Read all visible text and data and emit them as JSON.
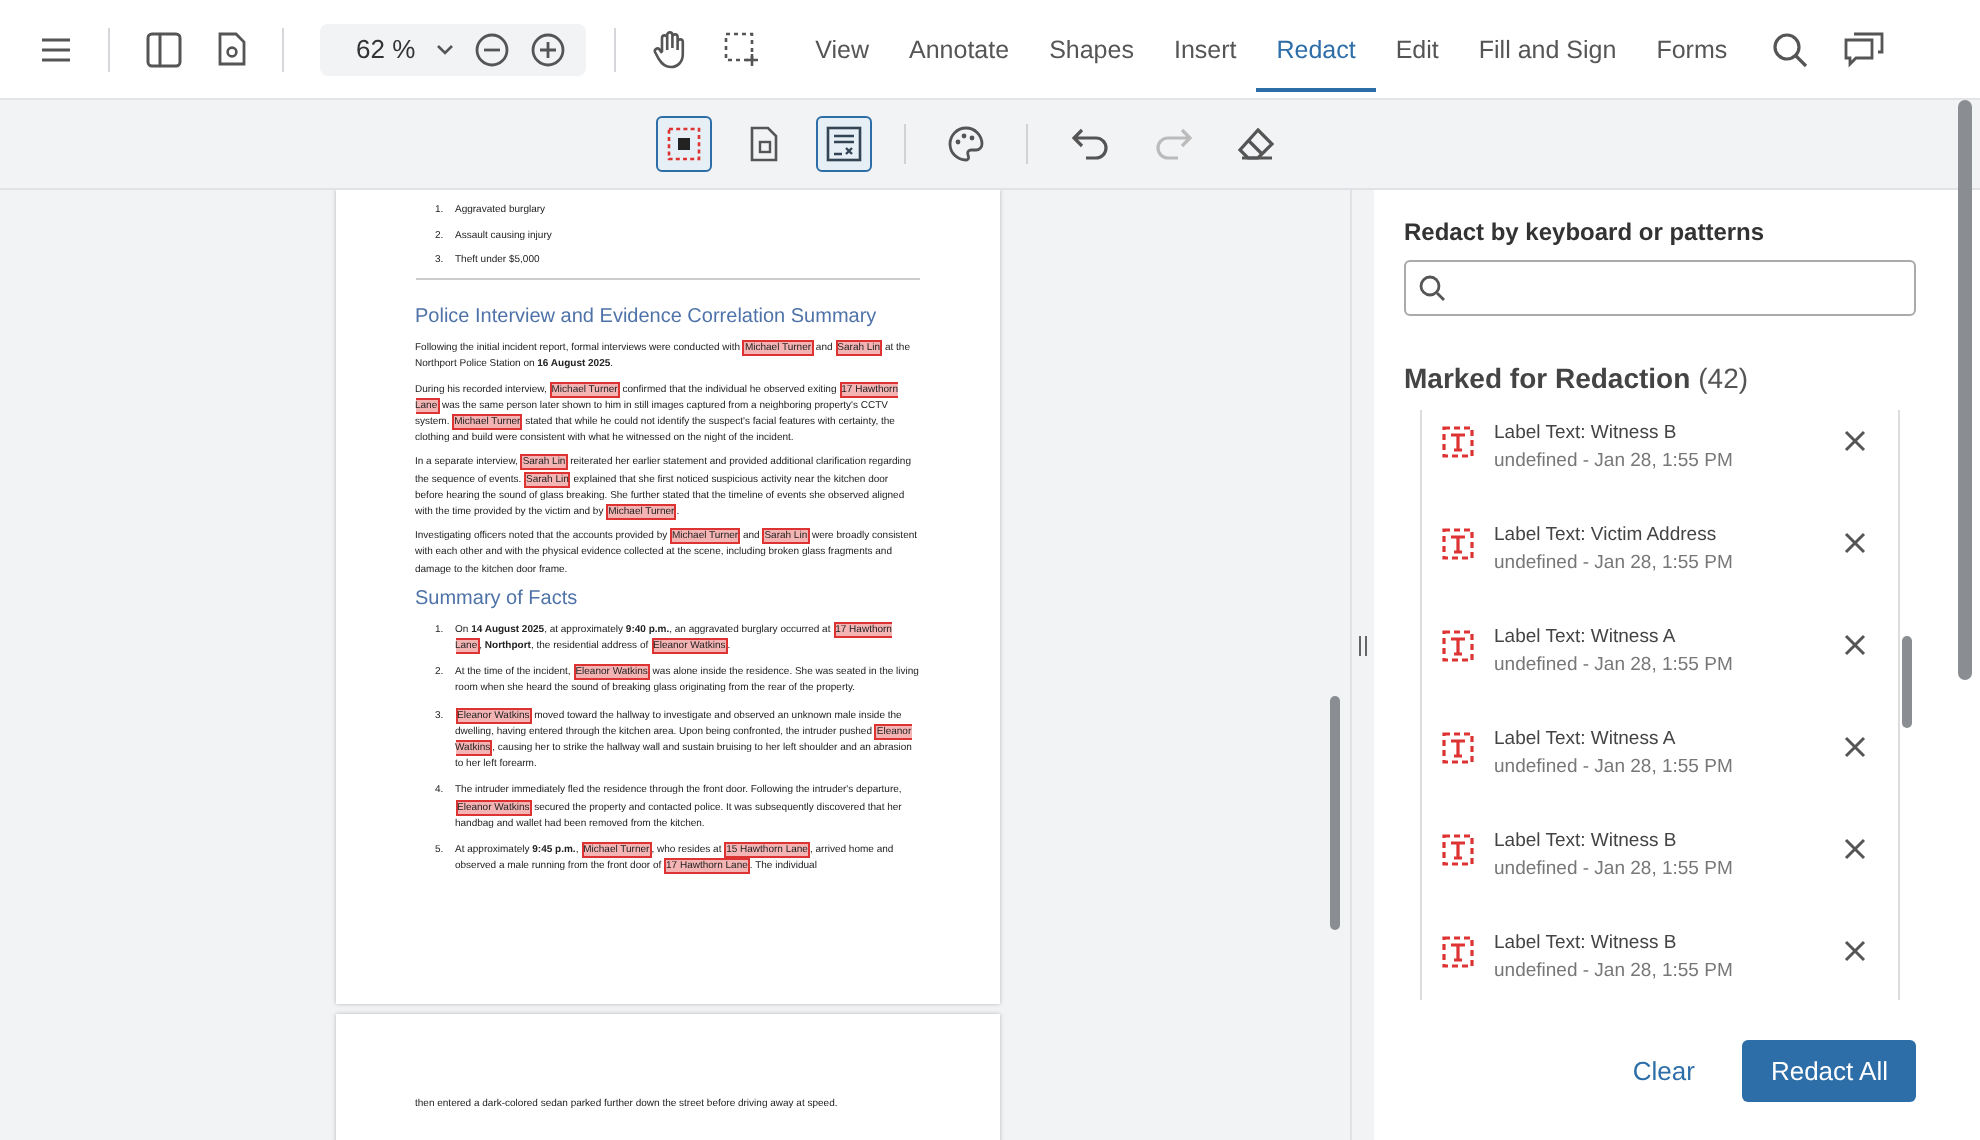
{
  "toolbar": {
    "zoom": "62 %",
    "tabs": [
      {
        "label": "View",
        "selected": false
      },
      {
        "label": "Annotate",
        "selected": false
      },
      {
        "label": "Shapes",
        "selected": false
      },
      {
        "label": "Insert",
        "selected": false
      },
      {
        "label": "Redact",
        "selected": true
      },
      {
        "label": "Edit",
        "selected": false
      },
      {
        "label": "Fill and Sign",
        "selected": false
      },
      {
        "label": "Forms",
        "selected": false
      }
    ]
  },
  "redact_tools": [
    {
      "kind": "area",
      "selected": true
    },
    {
      "kind": "page",
      "selected": false
    },
    {
      "kind": "panel",
      "selected": true
    }
  ],
  "edit_tools": [
    {
      "kind": "palette",
      "disabled": false
    },
    {
      "kind": "undo",
      "disabled": false
    },
    {
      "kind": "redo",
      "disabled": true
    },
    {
      "kind": "eraser",
      "disabled": false
    }
  ],
  "document": {
    "pages": [
      {
        "blocks": [
          {
            "kind": "item",
            "number": "1.",
            "segments": [
              {
                "kind": "text",
                "text": "Aggravated burglary"
              }
            ]
          },
          {
            "kind": "item",
            "number": "2.",
            "segments": [
              {
                "kind": "text",
                "text": "Assault causing injury"
              }
            ]
          },
          {
            "kind": "item",
            "number": "3.",
            "segments": [
              {
                "kind": "text",
                "text": "Theft under $5,000"
              }
            ]
          },
          {
            "kind": "rule"
          },
          {
            "kind": "heading",
            "text": "Police Interview and Evidence Correlation Summary"
          },
          {
            "kind": "para",
            "segments": [
              {
                "kind": "text",
                "text": "Following the initial incident report, formal interviews were conducted with "
              },
              {
                "kind": "redacted",
                "text": "Michael Turner"
              },
              {
                "kind": "text",
                "text": " and "
              },
              {
                "kind": "redacted",
                "text": "Sarah Lin"
              },
              {
                "kind": "text",
                "text": " at the Northport Police Station on **16 August 2025**."
              }
            ]
          },
          {
            "kind": "para",
            "segments": [
              {
                "kind": "text",
                "text": "During his recorded interview, "
              },
              {
                "kind": "redacted",
                "text": "Michael Turner"
              },
              {
                "kind": "text",
                "text": " confirmed that the individual he observed exiting "
              },
              {
                "kind": "redacted",
                "text": "17 Hawthorn Lane"
              },
              {
                "kind": "text",
                "text": " was the same person later shown to him in still images captured from a neighboring property's CCTV system. "
              },
              {
                "kind": "redacted",
                "text": "Michael Turner"
              },
              {
                "kind": "text",
                "text": " stated that while he could not identify the suspect's facial features with certainty, the clothing and build were consistent with what he witnessed on the night of the incident."
              }
            ]
          },
          {
            "kind": "para",
            "segments": [
              {
                "kind": "text",
                "text": "In a separate interview, "
              },
              {
                "kind": "redacted",
                "text": "Sarah Lin"
              },
              {
                "kind": "text",
                "text": " reiterated her earlier statement and provided additional clarification regarding the sequence of events. "
              },
              {
                "kind": "redacted",
                "text": "Sarah Lin"
              },
              {
                "kind": "text",
                "text": " explained that she first noticed suspicious activity near the kitchen door before hearing the sound of glass breaking. She further stated that the timeline of events she observed aligned with the time provided by the victim and by "
              },
              {
                "kind": "redacted",
                "text": "Michael Turner"
              },
              {
                "kind": "text",
                "text": "."
              }
            ]
          },
          {
            "kind": "para",
            "segments": [
              {
                "kind": "text",
                "text": "Investigating officers noted that the accounts provided by "
              },
              {
                "kind": "redacted",
                "text": "Michael Turner"
              },
              {
                "kind": "text",
                "text": " and "
              },
              {
                "kind": "redacted",
                "text": "Sarah Lin"
              },
              {
                "kind": "text",
                "text": " were broadly consistent with each other and with the physical evidence collected at the scene, including broken glass fragments and damage to the kitchen door frame."
              }
            ]
          },
          {
            "kind": "heading",
            "text": "Summary of Facts"
          },
          {
            "kind": "fact",
            "number": "1.",
            "segments": [
              {
                "kind": "text",
                "text": "On **14 August 2025**, at approximately **9:40 p.m.**, an aggravated burglary occurred at "
              },
              {
                "kind": "redacted",
                "text": "17 Hawthorn Lane"
              },
              {
                "kind": "text",
                "text": ", **Northport**, the residential address of "
              },
              {
                "kind": "redacted",
                "text": "Eleanor Watkins"
              },
              {
                "kind": "text",
                "text": "."
              }
            ]
          },
          {
            "kind": "fact",
            "number": "2.",
            "segments": [
              {
                "kind": "text",
                "text": "At the time of the incident, "
              },
              {
                "kind": "redacted",
                "text": "Eleanor Watkins"
              },
              {
                "kind": "text",
                "text": " was alone inside the residence. She was seated in the living room when she heard the sound of breaking glass originating from the rear of the property."
              }
            ]
          },
          {
            "kind": "fact",
            "number": "3.",
            "segments": [
              {
                "kind": "redacted",
                "text": "Eleanor Watkins"
              },
              {
                "kind": "text",
                "text": " moved toward the hallway to investigate and observed an unknown male inside the dwelling, having entered through the kitchen area. Upon being confronted, the intruder pushed "
              },
              {
                "kind": "redacted",
                "text": "Eleanor Watkins"
              },
              {
                "kind": "text",
                "text": ", causing her to strike the hallway wall and sustain bruising to her left shoulder and an abrasion to her left forearm."
              }
            ]
          },
          {
            "kind": "fact",
            "number": "4.",
            "segments": [
              {
                "kind": "text",
                "text": "The intruder immediately fled the residence through the front door. Following the intruder's departure, "
              },
              {
                "kind": "redacted",
                "text": "Eleanor Watkins"
              },
              {
                "kind": "text",
                "text": " secured the property and contacted police. It was subsequently discovered that her handbag and wallet had been removed from the kitchen."
              }
            ]
          },
          {
            "kind": "fact",
            "number": "5.",
            "segments": [
              {
                "kind": "text",
                "text": "At approximately **9:45 p.m.**, "
              },
              {
                "kind": "redacted",
                "text": "Michael Turner"
              },
              {
                "kind": "text",
                "text": ", who resides at "
              },
              {
                "kind": "redacted",
                "text": "15 Hawthorn Lane"
              },
              {
                "kind": "text",
                "text": ", arrived home and observed a male running from the front door of "
              },
              {
                "kind": "redacted",
                "text": "17 Hawthorn Lane"
              },
              {
                "kind": "text",
                "text": ". The individual"
              }
            ]
          }
        ]
      },
      {
        "blocks": [
          {
            "kind": "continuation",
            "segments": [
              {
                "kind": "text",
                "text": "then entered a dark-colored sedan parked further down the street before driving away at speed."
              }
            ]
          }
        ]
      }
    ]
  },
  "panel": {
    "title": "Redact by keyboard or patterns",
    "marked_title": "Marked for Redaction",
    "count": "(42)",
    "items": [
      {
        "title": "Label Text: Witness B",
        "subtitle": "undefined - Jan 28, 1:55 PM"
      },
      {
        "title": "Label Text: Victim Address",
        "subtitle": "undefined - Jan 28, 1:55 PM"
      },
      {
        "title": "Label Text: Witness A",
        "subtitle": "undefined - Jan 28, 1:55 PM"
      },
      {
        "title": "Label Text: Witness A",
        "subtitle": "undefined - Jan 28, 1:55 PM"
      },
      {
        "title": "Label Text: Witness B",
        "subtitle": "undefined - Jan 28, 1:55 PM"
      },
      {
        "title": "Label Text: Witness B",
        "subtitle": "undefined - Jan 28, 1:55 PM"
      }
    ],
    "buttons": [
      {
        "kind": "secondary",
        "label": "Clear"
      },
      {
        "kind": "primary",
        "label": "Redact All"
      }
    ]
  }
}
